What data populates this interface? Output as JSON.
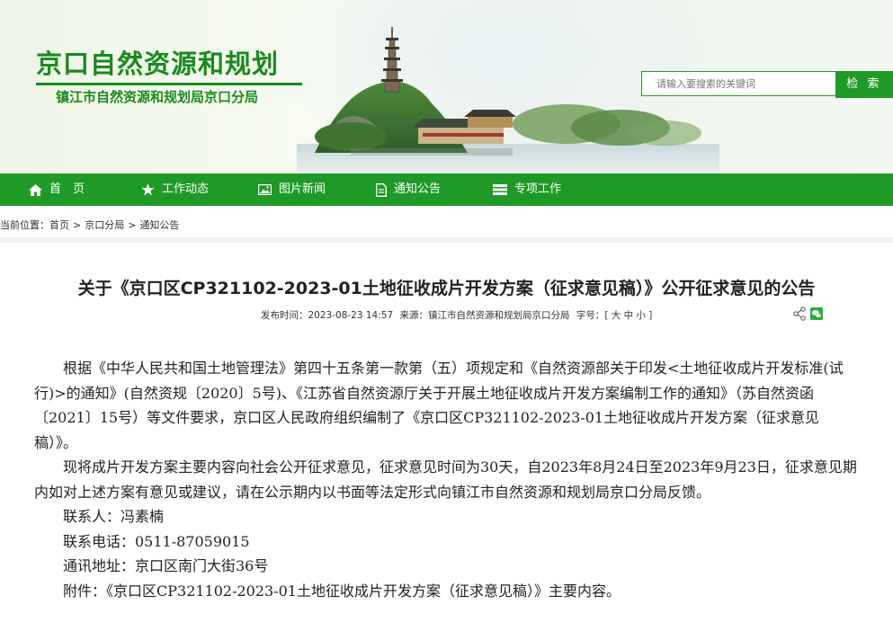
{
  "header": {
    "title": "京口自然资源和规划",
    "subtitle": "镇江市自然资源和规划局京口分局",
    "search_placeholder": "请输入要搜索的关键词",
    "search_button": "检 索"
  },
  "nav": {
    "items": [
      {
        "label": "首　页",
        "icon": "home-icon"
      },
      {
        "label": "工作动态",
        "icon": "star-icon"
      },
      {
        "label": "图片新闻",
        "icon": "image-icon"
      },
      {
        "label": "通知公告",
        "icon": "document-icon"
      },
      {
        "label": "专项工作",
        "icon": "list-icon"
      }
    ]
  },
  "breadcrumb": {
    "prefix": "当前位置：",
    "items": [
      "首页",
      "京口分局",
      "通知公告"
    ],
    "separator": ">"
  },
  "article": {
    "title": "关于《京口区CP321102-2023-01土地征收成片开发方案（征求意见稿）》公开征求意见的公告",
    "publish_label": "发布时间：",
    "publish_time": "2023-08-23 14:57",
    "source_label": "来源：",
    "source": "镇江市自然资源和规划局京口分局",
    "fontsize_label": "字号：",
    "fontsize_options": "[ 大 中 小 ]",
    "paragraphs": [
      "根据《中华人民共和国土地管理法》第四十五条第一款第（五）项规定和《自然资源部关于印发<土地征收成片开发标准(试行)>的通知》(自然资规〔2020〕5号)、《江苏省自然资源厅关于开展土地征收成片开发方案编制工作的通知》（苏自然资函〔2021〕15号）等文件要求，京口区人民政府组织编制了《京口区CP321102-2023-01土地征收成片开发方案（征求意见稿）》。",
      "现将成片开发方案主要内容向社会公开征求意见，征求意见时间为30天，自2023年8月24日至2023年9月23日，征求意见期内如对上述方案有意见或建议，请在公示期内以书面等法定形式向镇江市自然资源和规划局京口分局反馈。",
      "联系人：冯素楠",
      "联系电话：0511-87059015",
      "通讯地址：京口区南门大街36号",
      "附件：《京口区CP321102-2023-01土地征收成片开发方案（征求意见稿）》主要内容。"
    ]
  },
  "colors": {
    "brand_green": "#1f9a27",
    "title_green": "#1a8a1e"
  }
}
